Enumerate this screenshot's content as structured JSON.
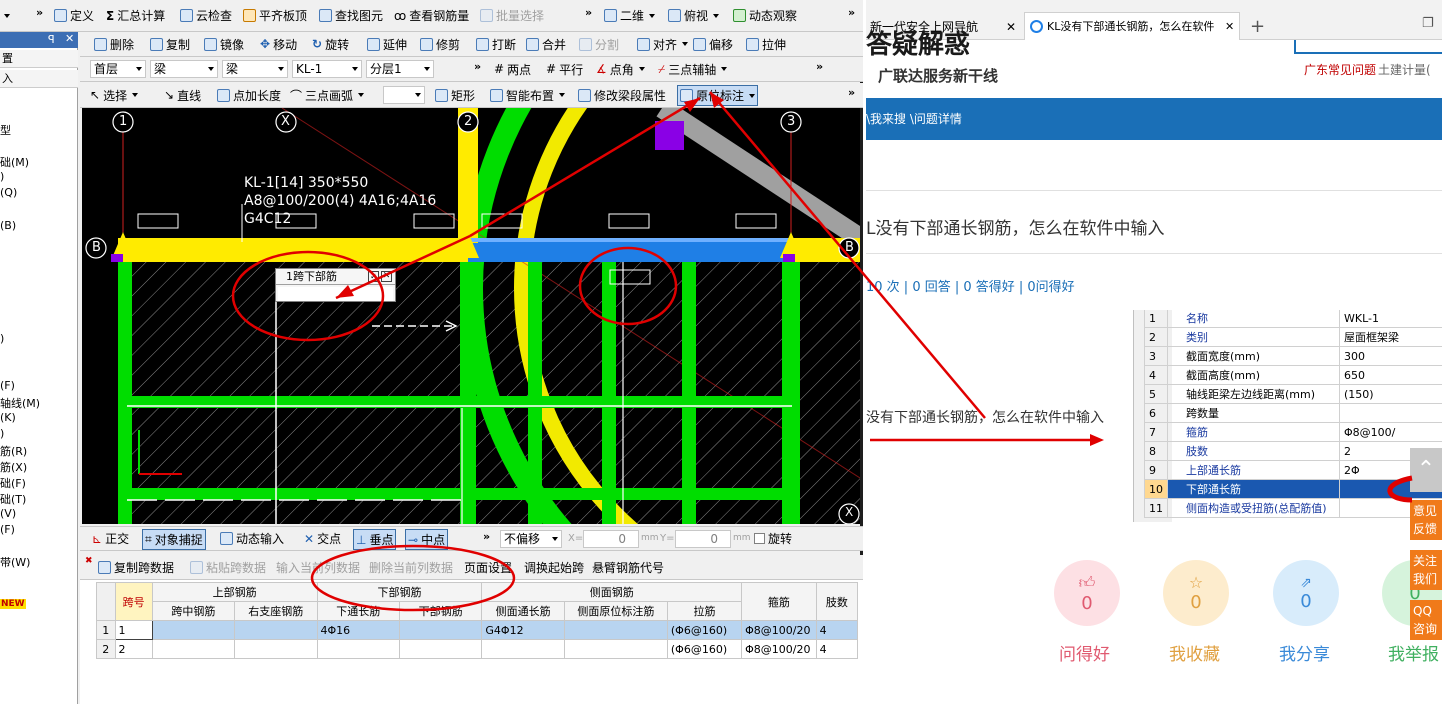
{
  "toolbar1": {
    "define": "定义",
    "sum_calc": "汇总计算",
    "cloud_check": "云检查",
    "flat_slab_top": "平齐板顶",
    "find_element": "查找图元",
    "view_rebar": "查看钢筋量",
    "batch_select": "批量选择",
    "view_2d": "二维",
    "view_top": "俯视",
    "dynamic_view": "动态观察"
  },
  "toolbar2": {
    "delete": "删除",
    "copy": "复制",
    "mirror": "镜像",
    "move": "移动",
    "rotate": "旋转",
    "extend": "延伸",
    "trim": "修剪",
    "break": "打断",
    "merge": "合并",
    "split": "分割",
    "align": "对齐",
    "offset": "偏移",
    "stretch": "拉伸"
  },
  "toolbar3": {
    "floor": "首层",
    "type1": "梁",
    "type2": "梁",
    "element": "KL-1",
    "layer": "分层1",
    "two_points": "两点",
    "parallel": "平行",
    "point_angle": "点角",
    "three_point_axis": "三点辅轴"
  },
  "toolbar4": {
    "select": "选择",
    "line": "直线",
    "point_length": "点加长度",
    "three_point_arc": "三点画弧",
    "rect": "矩形",
    "smart_layout": "智能布置",
    "modify_span": "修改梁段属性",
    "original_label": "原位标注"
  },
  "left_panel": {
    "header_items": [
      "置",
      "入"
    ],
    "items": [
      "型",
      "础(M)",
      ")",
      "(Q)",
      "(B)",
      ")",
      "(F)",
      "轴线(M)",
      "(K)",
      ")",
      "筋(R)",
      "筋(X)",
      "础(F)",
      "础(T)",
      "(V)",
      "(F)",
      "带(W)",
      "NEW"
    ]
  },
  "canvas": {
    "axis_labels": [
      "1",
      "X",
      "2",
      "3",
      "B",
      "B",
      "X"
    ],
    "beam_text": [
      "KL-1[14] 350*550",
      "A8@100/200(4) 4A16;4A16",
      "G4C12"
    ],
    "popup_label": "1跨下部筋"
  },
  "statusbar": {
    "ortho": "正交",
    "snap": "对象捕捉",
    "dyn_input": "动态输入",
    "intersection": "交点",
    "perpendicular": "垂点",
    "midpoint": "中点",
    "offset_mode": "不偏移",
    "x_label": "X=",
    "x_val": "0",
    "y_label": "Y=",
    "y_val": "0",
    "unit": "mm",
    "rotate": "旋转"
  },
  "grid_toolbar": {
    "copy_span": "复制跨数据",
    "paste_span": "粘贴跨数据",
    "input_col": "输入当前列数据",
    "delete_col": "删除当前列数据",
    "page_setup": "页面设置",
    "swap_start": "调换起始跨",
    "cantilever": "悬臂钢筋代号"
  },
  "grid": {
    "headers_top": [
      "跨号",
      "上部钢筋",
      "下部钢筋",
      "侧面钢筋",
      "箍筋",
      "肢数"
    ],
    "headers_sub": [
      "跨中钢筋",
      "右支座钢筋",
      "下通长筋",
      "下部钢筋",
      "侧面通长筋",
      "侧面原位标注筋",
      "拉筋"
    ],
    "rows": [
      {
        "idx": "1",
        "span": "1",
        "mid": "",
        "right": "",
        "bottom_cont": "4Φ16",
        "bottom": "",
        "side_cont": "G4Φ12",
        "side_orig": "",
        "tie": "(Φ6@160)",
        "stirrup": "Φ8@100/20",
        "legs": "4"
      },
      {
        "idx": "2",
        "span": "2",
        "mid": "",
        "right": "",
        "bottom_cont": "",
        "bottom": "",
        "side_cont": "",
        "side_orig": "",
        "tie": "(Φ6@160)",
        "stirrup": "Φ8@100/20",
        "legs": "4"
      }
    ]
  },
  "browser": {
    "tab1": "新一代安全上网导航",
    "tab2": "KL没有下部通长钢筋，怎么在软件",
    "logo_big": "答疑解惑",
    "logo_sub": "广联达服务新干线",
    "link_faq": "广东常见问题",
    "link_calc": "土建计量(",
    "breadcrumb": "\\我来搜 \\问题详情",
    "question_title": "L没有下部通长钢筋，怎么在软件中输入",
    "stats": "10 次 | 0 回答 | 0 答得好 | 0问得好",
    "body_text": "没有下部通长钢筋，怎么在软件中输入",
    "props": [
      [
        "1",
        "名称",
        "WKL-1"
      ],
      [
        "2",
        "类别",
        "屋面框架梁"
      ],
      [
        "3",
        "截面宽度(mm)",
        "300"
      ],
      [
        "4",
        "截面高度(mm)",
        "650"
      ],
      [
        "5",
        "轴线距梁左边线距离(mm)",
        "(150)"
      ],
      [
        "6",
        "跨数量",
        ""
      ],
      [
        "7",
        "箍筋",
        "Φ8@100/"
      ],
      [
        "8",
        "肢数",
        "2"
      ],
      [
        "9",
        "上部通长筋",
        "2Φ"
      ],
      [
        "10",
        "下部通长筋",
        ""
      ],
      [
        "11",
        "侧面构造或受扭筋(总配筋值)",
        ""
      ]
    ],
    "actions": [
      {
        "label": "问得好",
        "count": "0"
      },
      {
        "label": "我收藏",
        "count": "0"
      },
      {
        "label": "我分享",
        "count": "0"
      },
      {
        "label": "我举报",
        "count": "0"
      }
    ],
    "side_tabs": [
      "意见反馈",
      "关注我们",
      "QQ咨询"
    ]
  },
  "colors": {
    "canvas_bg": "#000000",
    "beam_yellow": "#ffeb00",
    "beam_blue": "#1f7fe6",
    "green": "#00dd00",
    "annot_red": "#e00000",
    "blue_bar": "#1a6fb7"
  }
}
